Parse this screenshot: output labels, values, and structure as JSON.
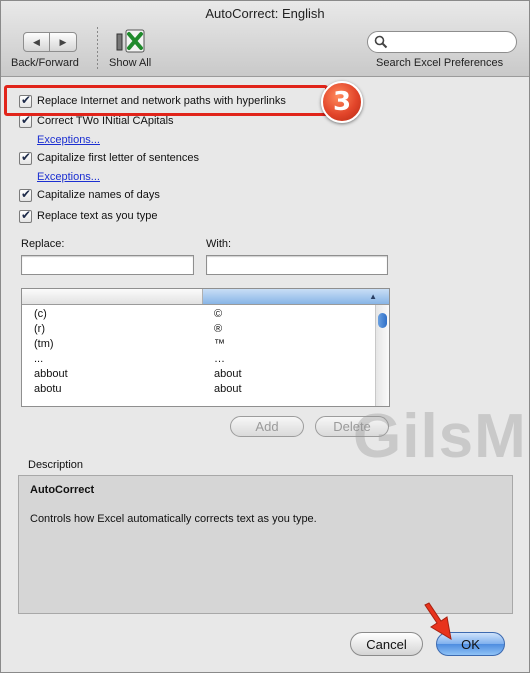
{
  "window": {
    "title": "AutoCorrect: English"
  },
  "toolbar": {
    "back_forward_label": "Back/Forward",
    "show_all_label": "Show All",
    "search_label": "Search Excel Preferences",
    "search_placeholder": ""
  },
  "options": [
    {
      "label": "Replace Internet and network paths with hyperlinks",
      "checked": true
    },
    {
      "label": "Correct TWo INitial CApitals",
      "checked": true
    },
    {
      "label": "Capitalize first letter of sentences",
      "checked": true
    },
    {
      "label": "Capitalize names of days",
      "checked": true
    },
    {
      "label": "Replace text as you type",
      "checked": true
    }
  ],
  "links": {
    "exceptions_1": "Exceptions...",
    "exceptions_2": "Exceptions..."
  },
  "annotation": {
    "step_number": "3",
    "highlight_color": "#e1241a"
  },
  "fields": {
    "replace_label": "Replace:",
    "with_label": "With:",
    "replace_value": "",
    "with_value": ""
  },
  "table": {
    "rows": [
      {
        "replace": "(c)",
        "with": "©"
      },
      {
        "replace": "(r)",
        "with": "®"
      },
      {
        "replace": "(tm)",
        "with": "™"
      },
      {
        "replace": "...",
        "with": "…"
      },
      {
        "replace": "abbout",
        "with": "about"
      },
      {
        "replace": "abotu",
        "with": "about"
      }
    ]
  },
  "buttons": {
    "add": "Add",
    "delete": "Delete",
    "cancel": "Cancel",
    "ok": "OK"
  },
  "watermark": "GilsMethod",
  "description": {
    "label": "Description",
    "title": "AutoCorrect",
    "text": "Controls how Excel automatically corrects text as you type."
  },
  "colors": {
    "accent": "#4e8de0",
    "link": "#1b2fd1",
    "arrow": "#e8331c"
  }
}
